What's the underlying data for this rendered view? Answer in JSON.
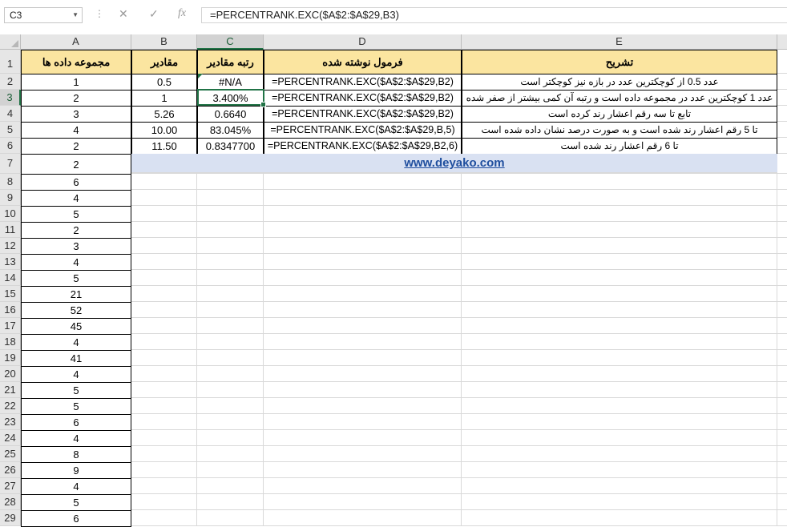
{
  "formula_bar": {
    "name_box": "C3",
    "cancel_icon": "✕",
    "enter_icon": "✓",
    "fx_label": "fx",
    "formula": "=PERCENTRANK.EXC($A$2:$A$29,B3)"
  },
  "columns": [
    "A",
    "B",
    "C",
    "D",
    "E"
  ],
  "selected_column": "C",
  "selected_row": "3",
  "header_row": {
    "A": "مجموعه داده ها",
    "B": "مقادیر",
    "C": "رتبه مقادیر",
    "D": "فرمول نوشته شده",
    "E": "تشریح"
  },
  "table_rows": [
    {
      "row": "2",
      "A": "1",
      "B": "0.5",
      "C": "#N/A",
      "D": "=PERCENTRANK.EXC($A$2:$A$29,B2)",
      "E": "عدد 0.5 از کوچکترین عدد در بازه نیز کوچکتر است"
    },
    {
      "row": "3",
      "A": "2",
      "B": "1",
      "C": "3.400%",
      "D": "=PERCENTRANK.EXC($A$2:$A$29,B2)",
      "E": "عدد 1 کوچکترین عدد در مجموعه داده است و رتبه آن کمی بیشتر از صفر شده"
    },
    {
      "row": "4",
      "A": "3",
      "B": "5.26",
      "C": "0.6640",
      "D": "=PERCENTRANK.EXC($A$2:$A$29,B2)",
      "E": "تابع تا سه رقم اعشار رند کرده است"
    },
    {
      "row": "5",
      "A": "4",
      "B": "10.00",
      "C": "83.045%",
      "D": "=PERCENTRANK.EXC($A$2:$A$29,B,5)",
      "E": "تا 5 رقم اعشار رند شده است و به صورت درصد نشان داده شده است"
    },
    {
      "row": "6",
      "A": "2",
      "B": "11.50",
      "C": "0.8347700",
      "D": "=PERCENTRANK.EXC($A$2:$A$29,B2,6)",
      "E": "تا 6 رقم اعشار رند شده است"
    }
  ],
  "banner": "www.deyako.com",
  "column_a_rows": [
    {
      "row": "7",
      "A": "2"
    },
    {
      "row": "8",
      "A": "6"
    },
    {
      "row": "9",
      "A": "4"
    },
    {
      "row": "10",
      "A": "5"
    },
    {
      "row": "11",
      "A": "2"
    },
    {
      "row": "12",
      "A": "3"
    },
    {
      "row": "13",
      "A": "4"
    },
    {
      "row": "14",
      "A": "5"
    },
    {
      "row": "15",
      "A": "21"
    },
    {
      "row": "16",
      "A": "52"
    },
    {
      "row": "17",
      "A": "45"
    },
    {
      "row": "18",
      "A": "4"
    },
    {
      "row": "19",
      "A": "41"
    },
    {
      "row": "20",
      "A": "4"
    },
    {
      "row": "21",
      "A": "5"
    },
    {
      "row": "22",
      "A": "5"
    },
    {
      "row": "23",
      "A": "6"
    },
    {
      "row": "24",
      "A": "4"
    },
    {
      "row": "25",
      "A": "8"
    },
    {
      "row": "26",
      "A": "9"
    },
    {
      "row": "27",
      "A": "4"
    },
    {
      "row": "28",
      "A": "5"
    },
    {
      "row": "29",
      "A": "6"
    }
  ],
  "colors": {
    "header_fill": "#fbe5a0",
    "banner_fill": "#d9e1f2",
    "selection": "#217346",
    "link": "#1f4e9e"
  }
}
